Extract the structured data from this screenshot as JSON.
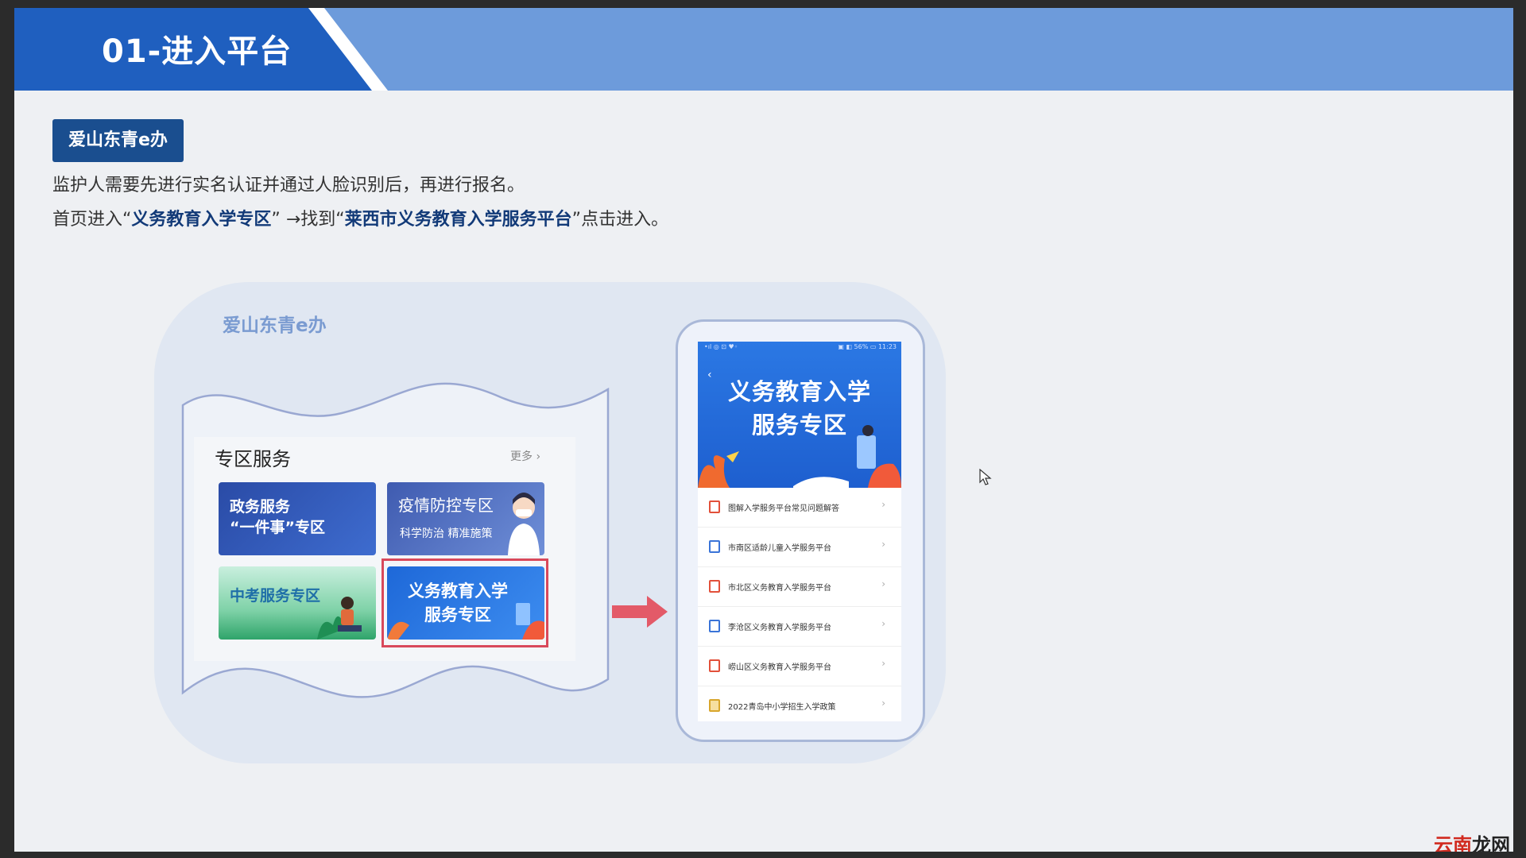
{
  "header": {
    "title": "01-进入平台"
  },
  "badge": {
    "label": "爱山东青e办"
  },
  "description": {
    "line1": "监护人需要先进行实名认证并通过人脸识别后，再进行报名。",
    "line2_prefix": "首页进入“",
    "line2_bold1": "义务教育入学专区",
    "line2_mid": "” →找到“",
    "line2_bold2": "莱西市义务教育入学服务平台",
    "line2_suffix": "”点击进入。"
  },
  "illustration": {
    "app_label": "爱山东青e办",
    "zone": {
      "title": "专区服务",
      "more": "更多",
      "tiles": [
        {
          "line1": "政务服务",
          "line2": "“一件事”专区"
        },
        {
          "line1": "疫情防控专区",
          "sub": "科学防治 精准施策"
        },
        {
          "line1": "中考服务专区"
        },
        {
          "line1": "义务教育入学",
          "line2": "服务专区"
        }
      ]
    },
    "phone": {
      "status_left": "•ıl ◎ ⊡ ♥◦",
      "status_right": "▣ ◧ 56% ▭ 11:23",
      "banner_line1": "义务教育入学",
      "banner_line2": "服务专区",
      "list": [
        {
          "label": "图解入学服务平台常见问题解答",
          "icon": "mail-icon"
        },
        {
          "label": "市南区适龄儿童入学服务平台",
          "icon": "doc-blue-icon"
        },
        {
          "label": "市北区义务教育入学服务平台",
          "icon": "doc-red-icon"
        },
        {
          "label": "李沧区义务教育入学服务平台",
          "icon": "doc-blue-icon"
        },
        {
          "label": "崂山区义务教育入学服务平台",
          "icon": "doc-red-icon"
        },
        {
          "label": "2022青岛中小学招生入学政策",
          "icon": "id-card-icon"
        }
      ]
    }
  },
  "watermark": {
    "part1": "云南",
    "part2": "龙网"
  },
  "colors": {
    "header_dark": "#1f5fbf",
    "header_light": "#6d9bdb",
    "badge_bg": "#1a4e8f",
    "highlight_border": "#d9495b",
    "arrow": "#e35a68"
  }
}
